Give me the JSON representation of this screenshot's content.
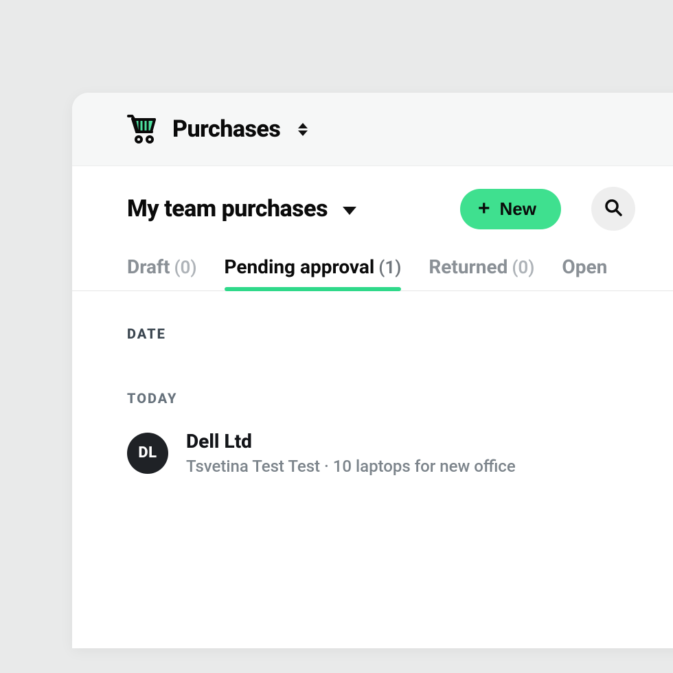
{
  "topbar": {
    "module_title": "Purchases"
  },
  "subheader": {
    "section_title": "My team purchases",
    "new_button_label": "New"
  },
  "tabs": [
    {
      "label": "Draft",
      "count": "(0)",
      "active": false
    },
    {
      "label": "Pending approval",
      "count": "(1)",
      "active": true
    },
    {
      "label": "Returned",
      "count": "(0)",
      "active": false
    },
    {
      "label": "Open",
      "count": "",
      "active": false
    }
  ],
  "list": {
    "column_header": "DATE",
    "group_label": "TODAY",
    "rows": [
      {
        "avatar_initials": "DL",
        "vendor": "Dell Ltd",
        "subtitle": "Tsvetina Test Test · 10 laptops for new office"
      }
    ]
  },
  "colors": {
    "accent": "#3fe08f",
    "tab_underline": "#2fd98a"
  }
}
